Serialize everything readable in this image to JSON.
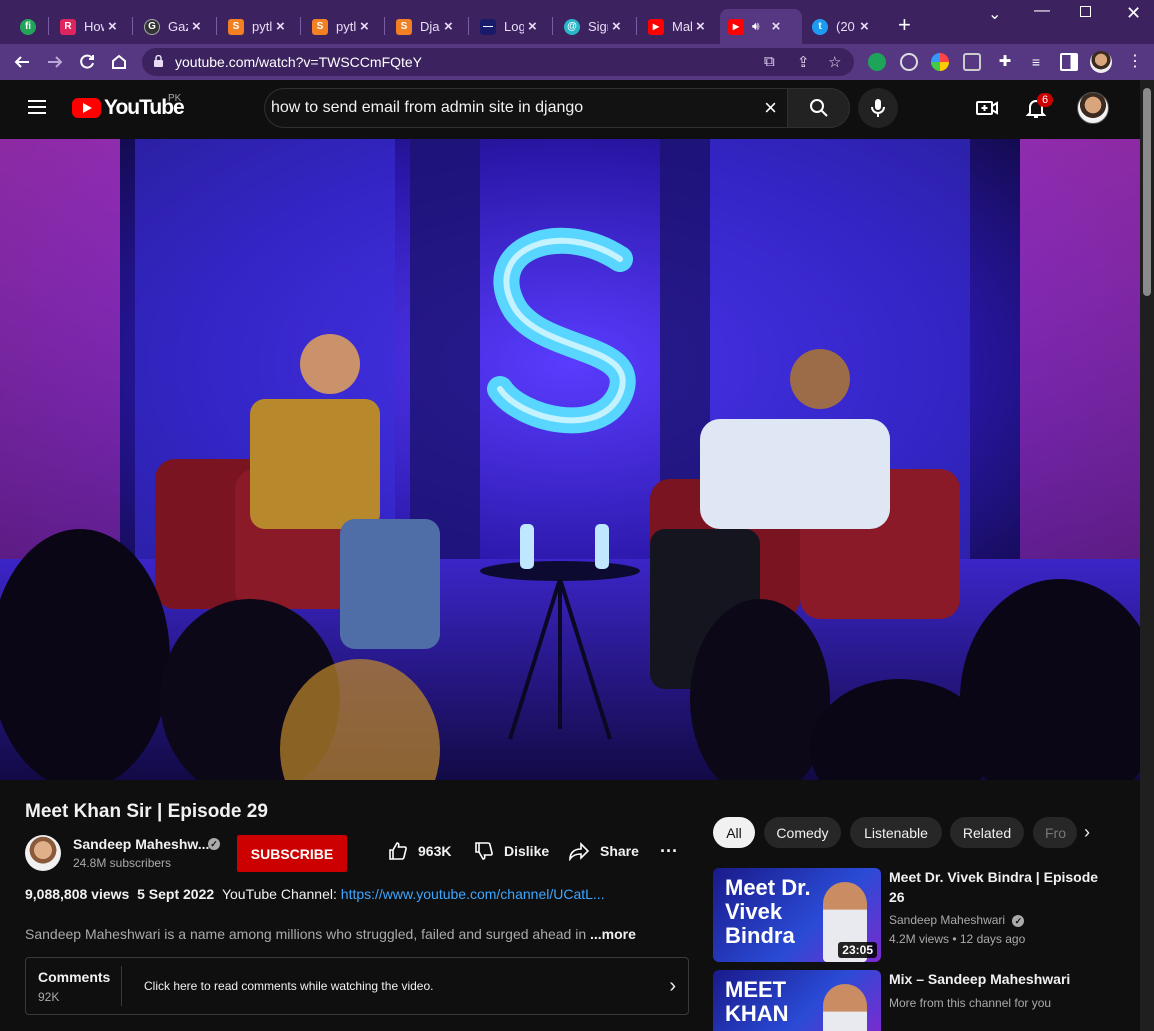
{
  "browser": {
    "tabs": [
      {
        "title": "fi",
        "fav_color": "#23a559",
        "fav_text": "fi"
      },
      {
        "title": "How",
        "fav_color": "#e0245e",
        "fav_text": "R"
      },
      {
        "title": "Gaz",
        "fav_color": "#333333",
        "fav_text": "G"
      },
      {
        "title": "pytl",
        "fav_color": "#f48024",
        "fav_text": "S"
      },
      {
        "title": "pytl",
        "fav_color": "#f48024",
        "fav_text": "S"
      },
      {
        "title": "Djar",
        "fav_color": "#f48024",
        "fav_text": "S"
      },
      {
        "title": "Log",
        "fav_color": "#1a1a6a",
        "fav_text": "—"
      },
      {
        "title": "Sigr",
        "fav_color": "#2bb5c8",
        "fav_text": "@"
      },
      {
        "title": "Mal",
        "fav_color": "#ff0000",
        "fav_text": "▶"
      },
      {
        "title": "",
        "fav_color": "#ff0000",
        "fav_text": "▶"
      },
      {
        "title": "(20",
        "fav_color": "#1d9bf0",
        "fav_text": "t"
      }
    ],
    "url": "youtube.com/watch?v=TWSCCmFQteY"
  },
  "masthead": {
    "logo_text": "YouTube",
    "country_code": "PK",
    "search_query": "how to send email from admin site in django",
    "notification_count": "6"
  },
  "video": {
    "title": "Meet Khan Sir | Episode 29",
    "channel_name": "Sandeep Maheshw...",
    "subscribers": "24.8M subscribers",
    "subscribe_label": "SUBSCRIBE",
    "likes": "963K",
    "dislike_label": "Dislike",
    "share_label": "Share",
    "more_actions": "···",
    "views": "9,088,808 views",
    "date": "5 Sept 2022",
    "channel_prefix": "YouTube Channel:",
    "channel_link": "https://www.youtube.com/channel/UCatL...",
    "description": "Sandeep Maheshwari is a name among millions who struggled, failed and surged ahead in",
    "more_label": "...more",
    "comments_label": "Comments",
    "comments_count": "92K",
    "comments_message": "Click here to read comments while watching the video."
  },
  "chips": [
    "All",
    "Comedy",
    "Listenable",
    "Related",
    "Fro"
  ],
  "recommendations": [
    {
      "title": "Meet Dr. Vivek Bindra | Episode 26",
      "channel": "Sandeep Maheshwari",
      "meta": "4.2M views • 12 days ago",
      "thumb_text": "Meet Dr. Vivek Bindra",
      "duration": "23:05"
    },
    {
      "title": "Mix – Sandeep Maheshwari",
      "channel": "More from this channel for you",
      "thumb_text": "MEET KHAN"
    }
  ],
  "colors": {
    "browser_frame": "#3c2360",
    "browser_toolbar": "#553782",
    "youtube_red": "#cc0000",
    "link_blue": "#3ea6ff"
  }
}
